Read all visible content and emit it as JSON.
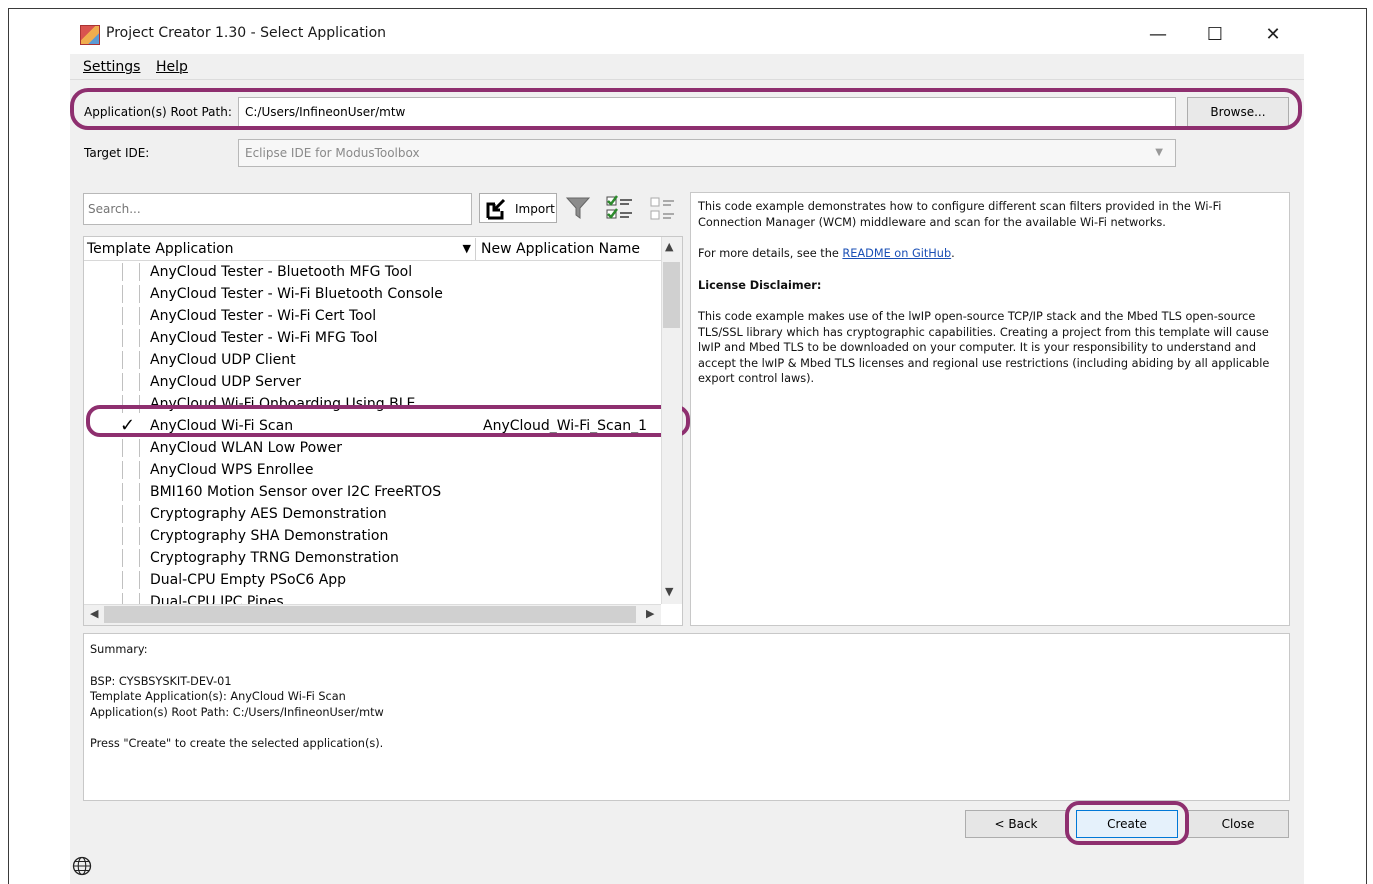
{
  "window": {
    "title": "Project Creator 1.30 - Select Application",
    "minimize": "—",
    "maximize": "☐",
    "close": "✕",
    "icon": "project-creator-icon"
  },
  "menu": {
    "settings": "Settings",
    "help": "Help"
  },
  "root_path": {
    "label": "Application(s) Root Path:",
    "value": "C:/Users/InfineonUser/mtw",
    "browse_label": "Browse..."
  },
  "target_ide": {
    "label": "Target IDE:",
    "value": "Eclipse IDE for ModusToolbox"
  },
  "search": {
    "placeholder": "Search..."
  },
  "toolbar": {
    "import_label": "Import"
  },
  "table": {
    "col_template": "Template Application",
    "col_new_name": "New Application Name",
    "rows": [
      {
        "name": "AnyCloud Tester - Bluetooth MFG Tool",
        "app_name": "",
        "checked": false
      },
      {
        "name": "AnyCloud Tester - Wi-Fi Bluetooth Console",
        "app_name": "",
        "checked": false
      },
      {
        "name": "AnyCloud Tester - Wi-Fi Cert Tool",
        "app_name": "",
        "checked": false
      },
      {
        "name": "AnyCloud Tester - Wi-Fi MFG Tool",
        "app_name": "",
        "checked": false
      },
      {
        "name": "AnyCloud UDP Client",
        "app_name": "",
        "checked": false
      },
      {
        "name": "AnyCloud UDP Server",
        "app_name": "",
        "checked": false
      },
      {
        "name": "AnyCloud Wi-Fi Onboarding Using BLE",
        "app_name": "",
        "checked": false
      },
      {
        "name": "AnyCloud Wi-Fi Scan",
        "app_name": "AnyCloud_Wi-Fi_Scan_1",
        "checked": true
      },
      {
        "name": "AnyCloud WLAN Low Power",
        "app_name": "",
        "checked": false
      },
      {
        "name": "AnyCloud WPS Enrollee",
        "app_name": "",
        "checked": false
      },
      {
        "name": "BMI160 Motion Sensor over I2C FreeRTOS",
        "app_name": "",
        "checked": false
      },
      {
        "name": "Cryptography AES Demonstration",
        "app_name": "",
        "checked": false
      },
      {
        "name": "Cryptography SHA Demonstration",
        "app_name": "",
        "checked": false
      },
      {
        "name": "Cryptography TRNG Demonstration",
        "app_name": "",
        "checked": false
      },
      {
        "name": "Dual-CPU Empty PSoC6 App",
        "app_name": "",
        "checked": false
      },
      {
        "name": "Dual-CPU IPC Pipes",
        "app_name": "",
        "checked": false
      }
    ]
  },
  "description": {
    "intro": "This code example demonstrates how to configure different scan filters provided in the Wi-Fi Connection Manager (WCM) middleware and scan for the available Wi-Fi networks.",
    "details_prefix": "For more details, see the ",
    "details_link": "README on GitHub",
    "details_suffix": ".",
    "license_heading": "License Disclaimer:",
    "license_text": "This code example makes use of the lwIP open-source TCP/IP stack and the Mbed TLS open-source TLS/SSL library which has cryptographic capabilities. Creating a project from this template will cause lwIP and Mbed TLS to be downloaded on your computer. It is your responsibility to understand and accept the lwIP & Mbed TLS licenses and regional use restrictions (including abiding by all applicable export control laws)."
  },
  "summary": {
    "heading": "Summary:",
    "bsp": "BSP: CYSBSYSKIT-DEV-01",
    "template": "Template Application(s): AnyCloud Wi-Fi Scan",
    "root": "Application(s) Root Path: C:/Users/InfineonUser/mtw",
    "instruction": "Press \"Create\" to create the selected application(s)."
  },
  "buttons": {
    "back": "< Back",
    "create": "Create",
    "close": "Close"
  },
  "colors": {
    "highlight": "#8e2f6f",
    "link": "#1a4fb5"
  }
}
